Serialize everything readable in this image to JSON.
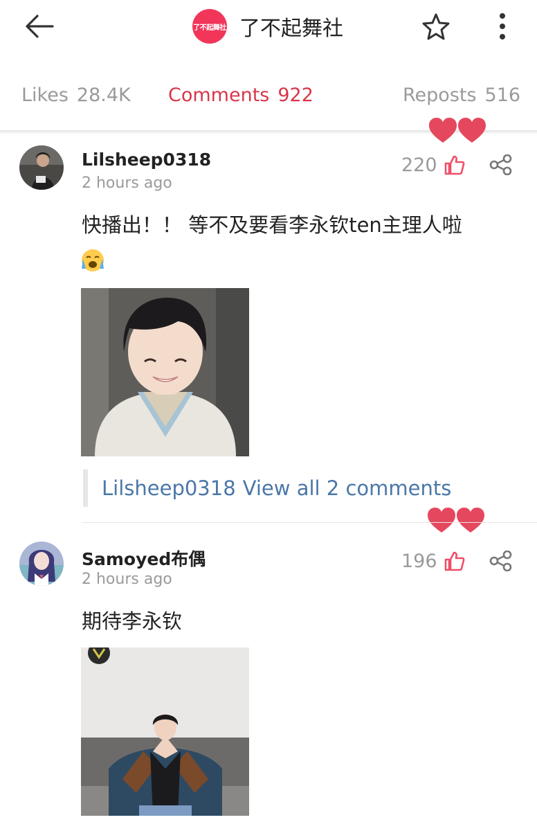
{
  "header": {
    "back_icon": "arrow-left-icon",
    "channel_name": "了不起舞社",
    "channel_logo_text": "了不起舞社",
    "star_icon": "star-outline-icon",
    "more_icon": "more-vertical-icon"
  },
  "tabs": {
    "likes": {
      "label": "Likes",
      "count": "28.4K"
    },
    "comments": {
      "label": "Comments",
      "count": "922"
    },
    "reposts": {
      "label": "Reposts",
      "count": "516"
    }
  },
  "colors": {
    "active_tab": "#d8364a",
    "accent_pink": "#ef4f68",
    "link_blue": "#4a77a8",
    "heart": "#e5485e"
  },
  "comments": [
    {
      "username": "Lilsheep0318",
      "time": "2 hours ago",
      "likes": "220",
      "text": "快播出！！ 等不及要看李永钦ten主理人啦",
      "emoji": "😭",
      "replies": {
        "author": "Lilsheep0318",
        "label": "View all 2 comments"
      },
      "like_icon": "thumbs-up-icon",
      "share_icon": "share-icon"
    },
    {
      "username": "Samoyed布偶",
      "time": "2 hours ago",
      "likes": "196",
      "text": "期待李永钦",
      "like_icon": "thumbs-up-icon",
      "share_icon": "share-icon"
    }
  ]
}
